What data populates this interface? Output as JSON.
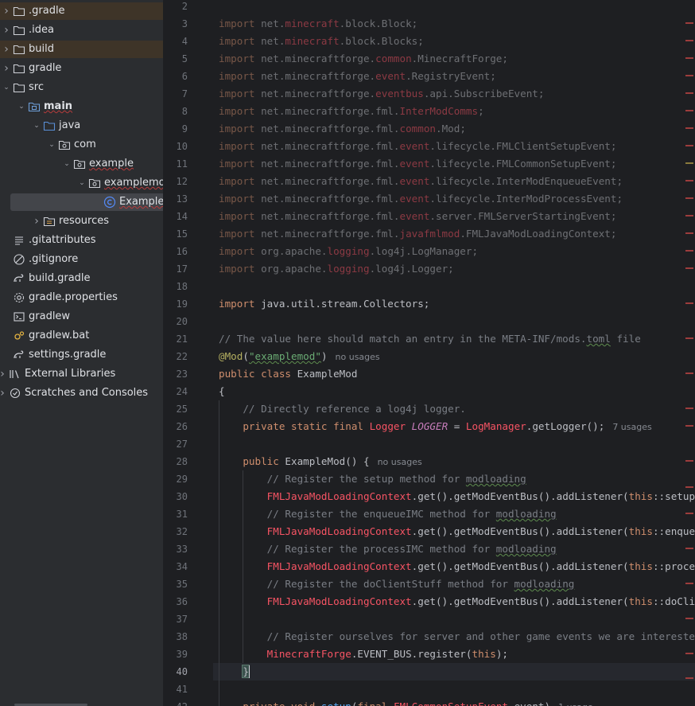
{
  "project_tree": {
    "rows": [
      {
        "label": "gradle",
        "display": ".gradle",
        "icon": "folder-icon",
        "depth": 0,
        "chevron": "right",
        "excluded": true
      },
      {
        "label": ".idea",
        "icon": "folder-icon",
        "depth": 0,
        "chevron": "right"
      },
      {
        "label": "build",
        "icon": "folder-icon",
        "depth": 0,
        "chevron": "right",
        "excluded": true
      },
      {
        "label": "gradle",
        "icon": "folder-icon",
        "depth": 0,
        "chevron": "right"
      },
      {
        "label": "src",
        "icon": "folder-icon",
        "depth": 0,
        "chevron": "down"
      },
      {
        "label": "main",
        "icon": "module-folder-icon",
        "depth": 1,
        "chevron": "down",
        "bold": true,
        "squiggle": true
      },
      {
        "label": "java",
        "icon": "source-folder-icon",
        "depth": 2,
        "chevron": "down"
      },
      {
        "label": "com",
        "icon": "package-icon",
        "depth": 3,
        "chevron": "down"
      },
      {
        "label": "example",
        "icon": "package-icon",
        "depth": 4,
        "chevron": "down",
        "squiggle": true
      },
      {
        "label": "examplemod",
        "icon": "package-icon",
        "depth": 5,
        "chevron": "down",
        "squiggle": true
      },
      {
        "label": "ExampleMod",
        "icon": "java-class-icon",
        "depth": 6,
        "chevron": "",
        "selected": true,
        "squiggle": true
      },
      {
        "label": "resources",
        "icon": "resources-folder-icon",
        "depth": 2,
        "chevron": "right"
      },
      {
        "label": ".gitattributes",
        "icon": "text-file-icon",
        "depth": 0,
        "chevron": ""
      },
      {
        "label": ".gitignore",
        "icon": "ignore-file-icon",
        "depth": 0,
        "chevron": ""
      },
      {
        "label": "build.gradle",
        "icon": "gradle-file-icon",
        "depth": 0,
        "chevron": ""
      },
      {
        "label": "gradle.properties",
        "icon": "settings-file-icon",
        "depth": 0,
        "chevron": ""
      },
      {
        "label": "gradlew",
        "icon": "script-file-icon",
        "depth": 0,
        "chevron": ""
      },
      {
        "label": "gradlew.bat",
        "icon": "batch-file-icon",
        "depth": 0,
        "chevron": ""
      },
      {
        "label": "settings.gradle",
        "icon": "gradle-file-icon",
        "depth": 0,
        "chevron": ""
      },
      {
        "label": "External Libraries",
        "icon": "libraries-icon",
        "depth": -1,
        "chevron": "right"
      },
      {
        "label": "Scratches and Consoles",
        "icon": "scratches-icon",
        "depth": -1,
        "chevron": "right"
      }
    ]
  },
  "editor": {
    "current_line": 40,
    "lines": [
      {
        "n": 2,
        "tokens": []
      },
      {
        "n": 3,
        "tokens": [
          [
            "kw",
            "import"
          ],
          [
            "p",
            " net."
          ],
          [
            "r",
            "minecraft"
          ],
          [
            "p",
            ".block.Block;"
          ]
        ]
      },
      {
        "n": 4,
        "tokens": [
          [
            "kw",
            "import"
          ],
          [
            "p",
            " net."
          ],
          [
            "r",
            "minecraft"
          ],
          [
            "p",
            ".block.Blocks;"
          ]
        ]
      },
      {
        "n": 5,
        "tokens": [
          [
            "kw",
            "import"
          ],
          [
            "p",
            " net.minecraftforge."
          ],
          [
            "r",
            "common"
          ],
          [
            "p",
            ".MinecraftForge;"
          ]
        ]
      },
      {
        "n": 6,
        "tokens": [
          [
            "kw",
            "import"
          ],
          [
            "p",
            " net.minecraftforge."
          ],
          [
            "r",
            "event"
          ],
          [
            "p",
            ".RegistryEvent;"
          ]
        ]
      },
      {
        "n": 7,
        "tokens": [
          [
            "kw",
            "import"
          ],
          [
            "p",
            " net.minecraftforge."
          ],
          [
            "r",
            "eventbus"
          ],
          [
            "p",
            ".api.SubscribeEvent;"
          ]
        ]
      },
      {
        "n": 8,
        "tokens": [
          [
            "kw",
            "import"
          ],
          [
            "p",
            " net.minecraftforge.fml."
          ],
          [
            "r",
            "InterModComms"
          ],
          [
            "p",
            ";"
          ]
        ]
      },
      {
        "n": 9,
        "tokens": [
          [
            "kw",
            "import"
          ],
          [
            "p",
            " net.minecraftforge.fml."
          ],
          [
            "r",
            "common"
          ],
          [
            "p",
            ".Mod;"
          ]
        ]
      },
      {
        "n": 10,
        "tokens": [
          [
            "kw",
            "import"
          ],
          [
            "p",
            " net.minecraftforge.fml."
          ],
          [
            "r",
            "event"
          ],
          [
            "p",
            ".lifecycle.FMLClientSetupEvent;"
          ]
        ]
      },
      {
        "n": 11,
        "tokens": [
          [
            "kw",
            "import"
          ],
          [
            "p",
            " net.minecraftforge.fml."
          ],
          [
            "r",
            "event"
          ],
          [
            "p",
            ".lifecycle.FMLCommonSetupEvent;"
          ]
        ]
      },
      {
        "n": 12,
        "tokens": [
          [
            "kw",
            "import"
          ],
          [
            "p",
            " net.minecraftforge.fml."
          ],
          [
            "r",
            "event"
          ],
          [
            "p",
            ".lifecycle.InterModEnqueueEvent;"
          ]
        ]
      },
      {
        "n": 13,
        "tokens": [
          [
            "kw",
            "import"
          ],
          [
            "p",
            " net.minecraftforge.fml."
          ],
          [
            "r",
            "event"
          ],
          [
            "p",
            ".lifecycle.InterModProcessEvent;"
          ]
        ]
      },
      {
        "n": 14,
        "tokens": [
          [
            "kw",
            "import"
          ],
          [
            "p",
            " net.minecraftforge.fml."
          ],
          [
            "r",
            "event"
          ],
          [
            "p",
            ".server.FMLServerStartingEvent;"
          ]
        ]
      },
      {
        "n": 15,
        "tokens": [
          [
            "kw",
            "import"
          ],
          [
            "p",
            " net.minecraftforge.fml."
          ],
          [
            "r",
            "javafmlmod"
          ],
          [
            "p",
            ".FMLJavaModLoadingContext;"
          ]
        ]
      },
      {
        "n": 16,
        "tokens": [
          [
            "kw",
            "import"
          ],
          [
            "p",
            " org.apache."
          ],
          [
            "r",
            "logging"
          ],
          [
            "p",
            ".log4j.LogManager;"
          ]
        ]
      },
      {
        "n": 17,
        "tokens": [
          [
            "kw",
            "import"
          ],
          [
            "p",
            " org.apache."
          ],
          [
            "r",
            "logging"
          ],
          [
            "p",
            ".log4j.Logger;"
          ]
        ]
      },
      {
        "n": 18,
        "tokens": []
      },
      {
        "n": 19,
        "tokens": [
          [
            "kw",
            "import"
          ],
          [
            "p",
            " java.util.stream.Collectors;"
          ]
        ],
        "bright": true
      },
      {
        "n": 20,
        "tokens": []
      },
      {
        "n": 21,
        "tokens": [
          [
            "c",
            "// The value here should match an entry in the META-INF/mods."
          ],
          [
            "csq",
            "toml"
          ],
          [
            "c",
            " file"
          ]
        ]
      },
      {
        "n": 22,
        "tokens": [
          [
            "ann",
            "@Mod"
          ],
          [
            "p",
            "("
          ],
          [
            "s",
            "\"examplemod\""
          ],
          [
            "p",
            ")"
          ],
          [
            "h",
            "no usages"
          ]
        ]
      },
      {
        "n": 23,
        "tokens": [
          [
            "kw",
            "public class "
          ],
          [
            "p",
            "ExampleMod"
          ]
        ]
      },
      {
        "n": 24,
        "tokens": [
          [
            "p",
            "{"
          ]
        ]
      },
      {
        "n": 25,
        "tokens": [
          [
            "p",
            "    "
          ],
          [
            "c",
            "// Directly reference a log4j logger."
          ]
        ]
      },
      {
        "n": 26,
        "tokens": [
          [
            "p",
            "    "
          ],
          [
            "kw",
            "private static final "
          ],
          [
            "r",
            "Logger "
          ],
          [
            "k",
            "LOGGER"
          ],
          [
            "p",
            " = "
          ],
          [
            "r",
            "LogManager"
          ],
          [
            "p",
            ".getLogger();"
          ],
          [
            "h",
            "7 usages"
          ]
        ]
      },
      {
        "n": 27,
        "tokens": []
      },
      {
        "n": 28,
        "tokens": [
          [
            "p",
            "    "
          ],
          [
            "kw",
            "public "
          ],
          [
            "p",
            "ExampleMod() {"
          ],
          [
            "h",
            "no usages"
          ]
        ]
      },
      {
        "n": 29,
        "tokens": [
          [
            "p",
            "        "
          ],
          [
            "c",
            "// Register the setup method for "
          ],
          [
            "csq",
            "modloading"
          ]
        ]
      },
      {
        "n": 30,
        "tokens": [
          [
            "p",
            "        "
          ],
          [
            "r",
            "FMLJavaModLoadingContext"
          ],
          [
            "p",
            ".get().getModEventBus().addListener("
          ],
          [
            "kw",
            "this"
          ],
          [
            "p",
            "::setup);"
          ]
        ]
      },
      {
        "n": 31,
        "tokens": [
          [
            "p",
            "        "
          ],
          [
            "c",
            "// Register the enqueueIMC method for "
          ],
          [
            "csq",
            "modloading"
          ]
        ]
      },
      {
        "n": 32,
        "tokens": [
          [
            "p",
            "        "
          ],
          [
            "r",
            "FMLJavaModLoadingContext"
          ],
          [
            "p",
            ".get().getModEventBus().addListener("
          ],
          [
            "kw",
            "this"
          ],
          [
            "p",
            "::enqueueIMC);"
          ]
        ]
      },
      {
        "n": 33,
        "tokens": [
          [
            "p",
            "        "
          ],
          [
            "c",
            "// Register the processIMC method for "
          ],
          [
            "csq",
            "modloading"
          ]
        ]
      },
      {
        "n": 34,
        "tokens": [
          [
            "p",
            "        "
          ],
          [
            "r",
            "FMLJavaModLoadingContext"
          ],
          [
            "p",
            ".get().getModEventBus().addListener("
          ],
          [
            "kw",
            "this"
          ],
          [
            "p",
            "::processIMC);"
          ]
        ]
      },
      {
        "n": 35,
        "tokens": [
          [
            "p",
            "        "
          ],
          [
            "c",
            "// Register the doClientStuff method for "
          ],
          [
            "csq",
            "modloading"
          ]
        ]
      },
      {
        "n": 36,
        "tokens": [
          [
            "p",
            "        "
          ],
          [
            "r",
            "FMLJavaModLoadingContext"
          ],
          [
            "p",
            ".get().getModEventBus().addListener("
          ],
          [
            "kw",
            "this"
          ],
          [
            "p",
            "::doClientStuff);"
          ]
        ]
      },
      {
        "n": 37,
        "tokens": []
      },
      {
        "n": 38,
        "tokens": [
          [
            "p",
            "        "
          ],
          [
            "c",
            "// Register ourselves for server and other game events we are interested in"
          ]
        ]
      },
      {
        "n": 39,
        "tokens": [
          [
            "p",
            "        "
          ],
          [
            "r",
            "MinecraftForge"
          ],
          [
            "p",
            ".EVENT_BUS.register("
          ],
          [
            "kw",
            "this"
          ],
          [
            "p",
            ");"
          ]
        ]
      },
      {
        "n": 40,
        "tokens": [
          [
            "p",
            "    "
          ],
          [
            "b",
            "}"
          ]
        ]
      },
      {
        "n": 41,
        "tokens": []
      },
      {
        "n": 42,
        "tokens": [
          [
            "p",
            "    "
          ],
          [
            "kw",
            "private void "
          ],
          [
            "fn",
            "setup"
          ],
          [
            "p",
            "("
          ],
          [
            "kw",
            "final "
          ],
          [
            "r",
            "FMLCommonSetupEvent"
          ],
          [
            "p",
            " event)"
          ],
          [
            "h",
            "1 usage"
          ]
        ]
      }
    ]
  },
  "error_stripe": {
    "markers": [
      {
        "line": 2.9,
        "kind": "error"
      },
      {
        "line": 3.9,
        "kind": "error"
      },
      {
        "line": 4.9,
        "kind": "error"
      },
      {
        "line": 5.9,
        "kind": "error"
      },
      {
        "line": 6.9,
        "kind": "error"
      },
      {
        "line": 7.9,
        "kind": "error"
      },
      {
        "line": 8.9,
        "kind": "error"
      },
      {
        "line": 9.9,
        "kind": "error"
      },
      {
        "line": 10.9,
        "kind": "warning"
      },
      {
        "line": 11.9,
        "kind": "error"
      },
      {
        "line": 12.9,
        "kind": "error"
      },
      {
        "line": 13.9,
        "kind": "error"
      },
      {
        "line": 14.9,
        "kind": "error"
      },
      {
        "line": 15.9,
        "kind": "error"
      },
      {
        "line": 16.9,
        "kind": "error"
      },
      {
        "line": 18.9,
        "kind": "error"
      },
      {
        "line": 20.9,
        "kind": "error"
      },
      {
        "line": 22.9,
        "kind": "error"
      },
      {
        "line": 24.9,
        "kind": "error"
      },
      {
        "line": 25.9,
        "kind": "error"
      },
      {
        "line": 27.9,
        "kind": "error"
      },
      {
        "line": 29.4,
        "kind": "error"
      },
      {
        "line": 30.9,
        "kind": "error"
      },
      {
        "line": 32.9,
        "kind": "error"
      },
      {
        "line": 34.9,
        "kind": "error"
      },
      {
        "line": 36.9,
        "kind": "error"
      },
      {
        "line": 38.9,
        "kind": "error"
      },
      {
        "line": 40.3,
        "kind": "error"
      }
    ]
  }
}
